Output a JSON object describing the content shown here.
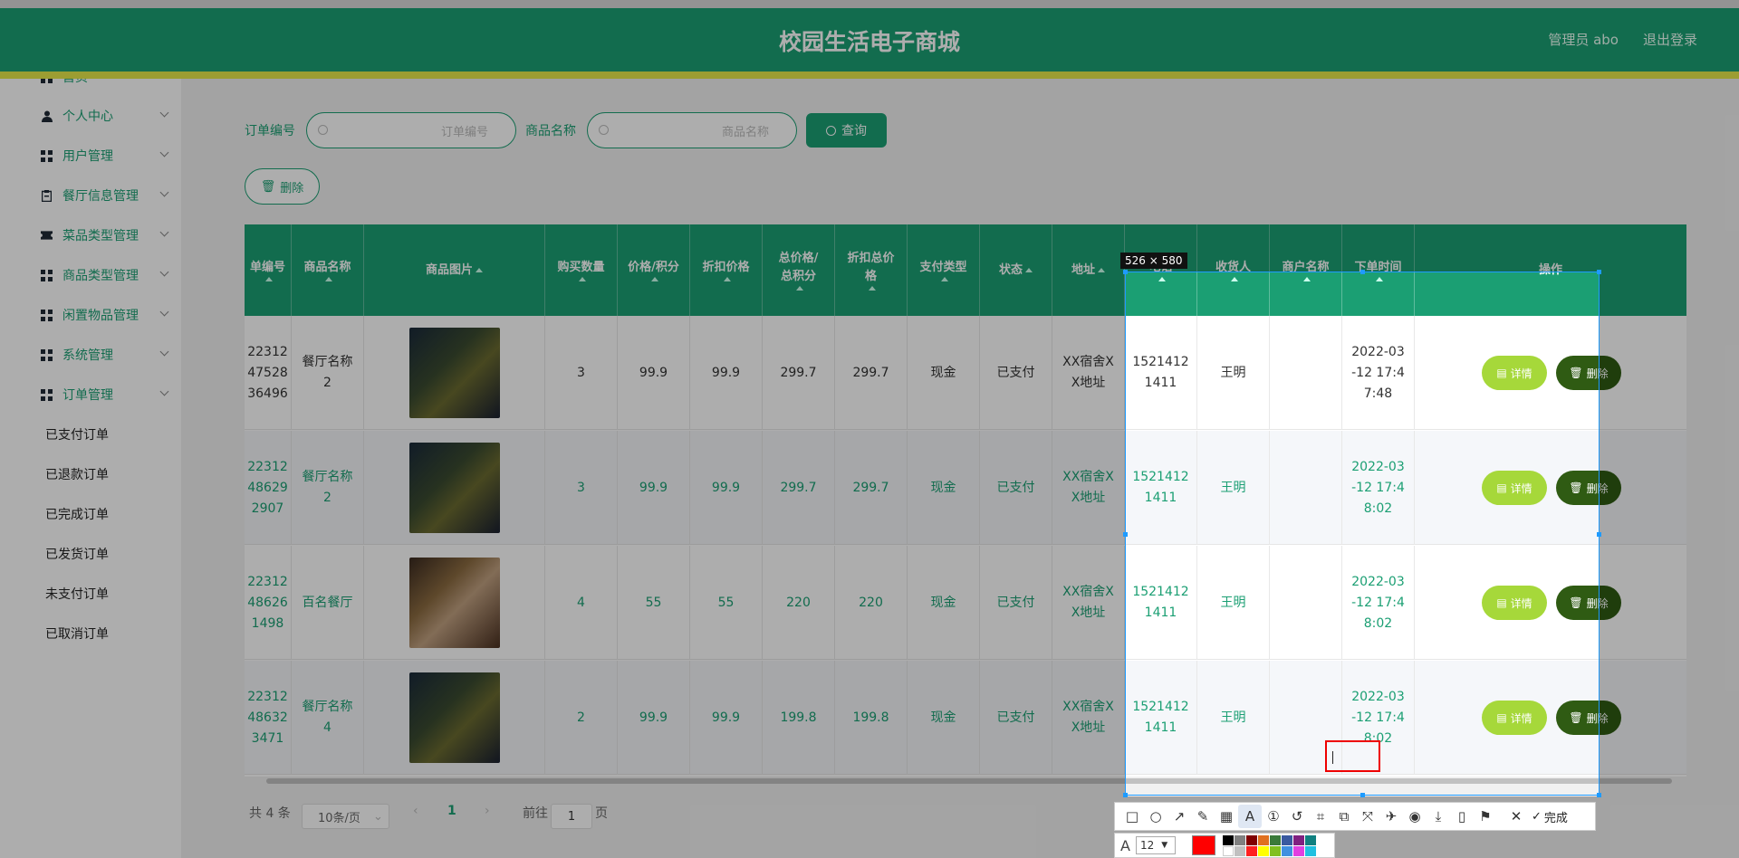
{
  "header": {
    "title": "校园生活电子商城",
    "user": "管理员 abo",
    "logout": "退出登录"
  },
  "sidebar": {
    "top_cut": "首页",
    "items": [
      {
        "label": "个人中心",
        "icon": "person-icon"
      },
      {
        "label": "用户管理",
        "icon": "grid-icon"
      },
      {
        "label": "餐厅信息管理",
        "icon": "clipboard-icon"
      },
      {
        "label": "菜品类型管理",
        "icon": "ticket-icon"
      },
      {
        "label": "商品类型管理",
        "icon": "grid-icon"
      },
      {
        "label": "闲置物品管理",
        "icon": "grid-icon"
      },
      {
        "label": "系统管理",
        "icon": "grid-icon"
      },
      {
        "label": "订单管理",
        "icon": "grid-icon"
      }
    ],
    "sub_items": [
      "已支付订单",
      "已退款订单",
      "已完成订单",
      "已发货订单",
      "未支付订单",
      "已取消订单"
    ]
  },
  "search": {
    "order_no_label": "订单编号",
    "order_no_placeholder": "订单编号",
    "product_label": "商品名称",
    "product_placeholder": "商品名称",
    "query_button": "查询",
    "delete_button": "删除"
  },
  "table": {
    "headers": {
      "order_no": "单编号",
      "product_name": "商品名称",
      "product_image": "商品图片",
      "quantity": "购买数量",
      "price": "价格/积分",
      "discount_price": "折扣价格",
      "total": "总价格/总积分",
      "discount_total": "折扣总价格",
      "pay_type": "支付类型",
      "status": "状态",
      "address": "地址",
      "phone": "电话",
      "receiver": "收货人",
      "merchant": "商户名称",
      "order_time": "下单时间",
      "actions": "操作"
    },
    "rows": [
      {
        "order_no": "22312\n47528\n36496",
        "product_name": "餐厅名称\n2",
        "quantity": "3",
        "price": "99.9",
        "discount_price": "99.9",
        "total": "299.7",
        "discount_total": "299.7",
        "pay_type": "现金",
        "status": "已支付",
        "address": "XX宿舍X\nX地址",
        "phone": "1521412\n1411",
        "receiver": "王明",
        "merchant": "",
        "order_time": "2022-03\n-12 17:4\n7:48"
      },
      {
        "order_no": "22312\n48629\n2907",
        "product_name": "餐厅名称\n2",
        "quantity": "3",
        "price": "99.9",
        "discount_price": "99.9",
        "total": "299.7",
        "discount_total": "299.7",
        "pay_type": "现金",
        "status": "已支付",
        "address": "XX宿舍X\nX地址",
        "phone": "1521412\n1411",
        "receiver": "王明",
        "merchant": "",
        "order_time": "2022-03\n-12 17:4\n8:02"
      },
      {
        "order_no": "22312\n48626\n1498",
        "product_name": "百名餐厅",
        "quantity": "4",
        "price": "55",
        "discount_price": "55",
        "total": "220",
        "discount_total": "220",
        "pay_type": "现金",
        "status": "已支付",
        "address": "XX宿舍X\nX地址",
        "phone": "1521412\n1411",
        "receiver": "王明",
        "merchant": "",
        "order_time": "2022-03\n-12 17:4\n8:02"
      },
      {
        "order_no": "22312\n48632\n3471",
        "product_name": "餐厅名称\n4",
        "quantity": "2",
        "price": "99.9",
        "discount_price": "99.9",
        "total": "199.8",
        "discount_total": "199.8",
        "pay_type": "现金",
        "status": "已支付",
        "address": "XX宿舍X\nX地址",
        "phone": "1521412\n1411",
        "receiver": "王明",
        "merchant": "",
        "order_time": "2022-03\n-12 17:4\n8:02"
      }
    ],
    "detail_button": "详情",
    "delete_button": "删除"
  },
  "pagination": {
    "total": "共 4 条",
    "page_size": "10条/页",
    "current_page": "1",
    "goto_label": "前往",
    "goto_value": "1",
    "page_suffix": "页"
  },
  "screenshot_tool": {
    "dimensions": "526 × 580",
    "done_label": "完成",
    "font_size": "12"
  },
  "colors": {
    "primary": "#1b9f73",
    "accent_yellow": "#e6e84a",
    "detail_btn": "#a6d83a",
    "delete_btn": "#2f5b13"
  }
}
